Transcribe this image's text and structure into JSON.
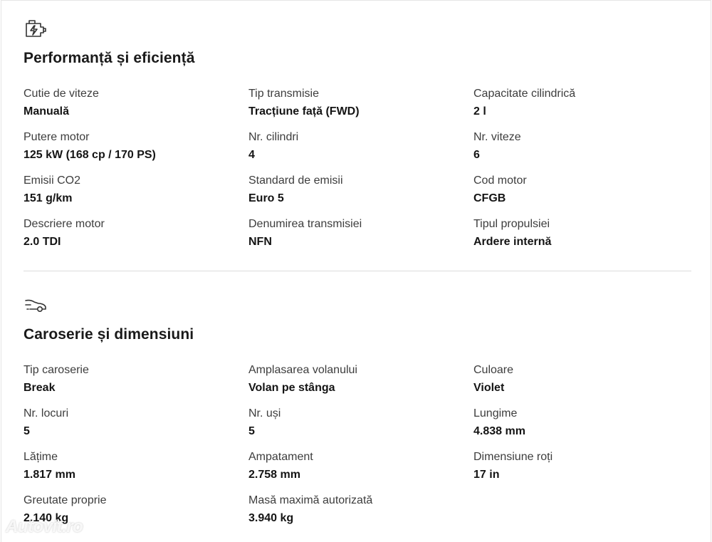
{
  "performance": {
    "title": "Performanță și eficiență",
    "icon": "engine-icon",
    "specs": [
      {
        "label": "Cutie de viteze",
        "value": "Manuală"
      },
      {
        "label": "Tip transmisie",
        "value": "Tracțiune față (FWD)"
      },
      {
        "label": "Capacitate cilindrică",
        "value": "2 l"
      },
      {
        "label": "Putere motor",
        "value": "125 kW (168 cp / 170 PS)"
      },
      {
        "label": "Nr. cilindri",
        "value": "4"
      },
      {
        "label": "Nr. viteze",
        "value": "6"
      },
      {
        "label": "Emisii CO2",
        "value": "151 g/km"
      },
      {
        "label": "Standard de emisii",
        "value": "Euro 5"
      },
      {
        "label": "Cod motor",
        "value": "CFGB"
      },
      {
        "label": "Descriere motor",
        "value": "2.0 TDI"
      },
      {
        "label": "Denumirea transmisiei",
        "value": "NFN"
      },
      {
        "label": "Tipul propulsiei",
        "value": "Ardere internă"
      }
    ]
  },
  "body": {
    "title": "Caroserie și dimensiuni",
    "icon": "car-icon",
    "specs": [
      {
        "label": "Tip caroserie",
        "value": "Break"
      },
      {
        "label": "Amplasarea volanului",
        "value": "Volan pe stânga"
      },
      {
        "label": "Culoare",
        "value": "Violet"
      },
      {
        "label": "Nr. locuri",
        "value": "5"
      },
      {
        "label": "Nr. uși",
        "value": "5"
      },
      {
        "label": "Lungime",
        "value": "4.838 mm"
      },
      {
        "label": "Lățime",
        "value": "1.817 mm"
      },
      {
        "label": "Ampatament",
        "value": "2.758 mm"
      },
      {
        "label": "Dimensiune roți",
        "value": "17 in"
      },
      {
        "label": "Greutate proprie",
        "value": "2.140 kg"
      },
      {
        "label": "Masă maximă autorizată",
        "value": "3.940 kg"
      }
    ]
  },
  "watermark": "Autovit.ro"
}
